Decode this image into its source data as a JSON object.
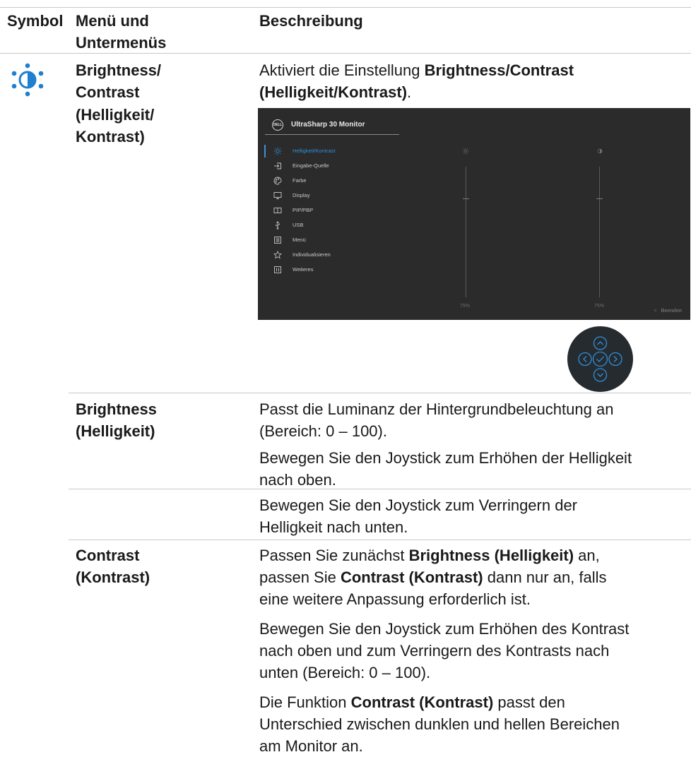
{
  "header": {
    "symbol": "Symbol",
    "menu_line1": "Menü und",
    "menu_line2": "Untermenüs",
    "description": "Beschreibung"
  },
  "row_brightness_contrast": {
    "icon": "brightness-contrast-icon",
    "menu_lines": [
      "Brightness/",
      "Contrast",
      "(Helligkeit/",
      "Kontrast)"
    ],
    "desc_prefix": "Aktiviert die Einstellung ",
    "desc_bold_1": "Brightness/Contrast",
    "desc_bold_2": "(Helligkeit/Kontrast)",
    "desc_suffix": "."
  },
  "osd": {
    "logo": "DELL",
    "title": "UltraSharp 30 Monitor",
    "menu_items": [
      {
        "label": "Helligkeit/Kontrast",
        "icon": "sun-icon",
        "active": true
      },
      {
        "label": "Eingabe-Quelle",
        "icon": "input-source-icon"
      },
      {
        "label": "Farbe",
        "icon": "palette-icon"
      },
      {
        "label": "Display",
        "icon": "monitor-icon"
      },
      {
        "label": "PIP/PBP",
        "icon": "pip-pbp-icon"
      },
      {
        "label": "USB",
        "icon": "usb-icon"
      },
      {
        "label": "Menü",
        "icon": "menu-icon"
      },
      {
        "label": "Individualisieren",
        "icon": "star-icon"
      },
      {
        "label": "Weiteres",
        "icon": "others-icon"
      }
    ],
    "brightness_value": "75%",
    "contrast_value": "75%",
    "exit_arrow": "<",
    "exit_label": "Beenden",
    "colors": {
      "background": "#2b2b2b",
      "accent": "#2f8fd8"
    }
  },
  "joystick": {
    "icon": "joystick-icon",
    "buttons": [
      "up",
      "left",
      "ok",
      "right",
      "down"
    ]
  },
  "row_brightness": {
    "menu_lines": [
      "Brightness",
      "(Helligkeit)"
    ],
    "para1_lines": [
      "Passt die Luminanz der Hintergrundbeleuchtung an",
      "(Bereich: 0 – 100)."
    ],
    "para2_lines": [
      "Bewegen Sie den Joystick zum Erhöhen der Helligkeit",
      "nach oben."
    ],
    "para3_lines": [
      "Bewegen Sie den Joystick zum Verringern der",
      "Helligkeit nach unten."
    ]
  },
  "row_contrast": {
    "menu_lines": [
      "Contrast",
      "(Kontrast)"
    ],
    "p1_l1_prefix": "Passen Sie zunächst ",
    "p1_l1_bold": "Brightness (Helligkeit)",
    "p1_l1_suffix": " an,",
    "p1_l2_prefix": "passen Sie ",
    "p1_l2_bold": "Contrast (Kontrast)",
    "p1_l2_suffix": " dann nur an, falls",
    "p1_l3": "eine weitere Anpassung erforderlich ist.",
    "para2_lines": [
      "Bewegen Sie den Joystick zum Erhöhen des Kontrast",
      "nach oben und zum Verringern des Kontrasts nach",
      "unten (Bereich: 0 – 100)."
    ],
    "p3_l1_prefix": "Die Funktion ",
    "p3_l1_bold": "Contrast (Kontrast)",
    "p3_l1_suffix": " passt den",
    "p3_l2": "Unterschied zwischen dunklen und hellen Bereichen",
    "p3_l3": "am Monitor an."
  },
  "colors": {
    "icon_blue": "#1f7fd0",
    "rule": "#c8c8c8"
  }
}
